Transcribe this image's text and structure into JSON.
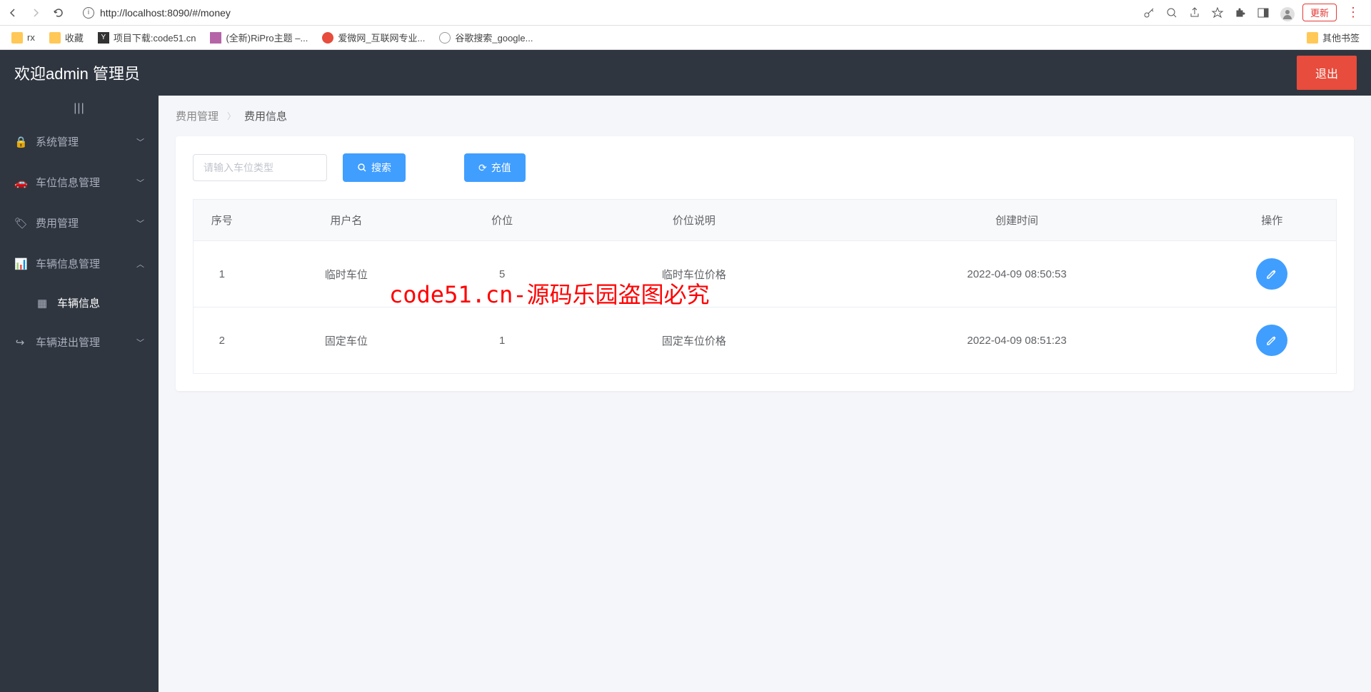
{
  "browser": {
    "url": "http://localhost:8090/#/money",
    "update_label": "更新"
  },
  "bookmarks": {
    "items": [
      {
        "label": "rx"
      },
      {
        "label": "收藏"
      },
      {
        "label": "项目下载:code51.cn"
      },
      {
        "label": "(全新)RiPro主题 –..."
      },
      {
        "label": "爱微网_互联网专业..."
      },
      {
        "label": "谷歌搜索_google..."
      }
    ],
    "other": "其他书签"
  },
  "header": {
    "title": "欢迎admin 管理员",
    "logout": "退出"
  },
  "sidebar": {
    "items": [
      {
        "label": "系统管理",
        "expanded": false
      },
      {
        "label": "车位信息管理",
        "expanded": false
      },
      {
        "label": "费用管理",
        "expanded": false
      },
      {
        "label": "车辆信息管理",
        "expanded": true,
        "children": [
          {
            "label": "车辆信息"
          }
        ]
      },
      {
        "label": "车辆进出管理",
        "expanded": false
      }
    ]
  },
  "breadcrumb": {
    "parent": "费用管理",
    "current": "费用信息"
  },
  "toolbar": {
    "search_placeholder": "请输入车位类型",
    "search_label": "搜索",
    "recharge_label": "充值"
  },
  "table": {
    "headers": [
      "序号",
      "用户名",
      "价位",
      "价位说明",
      "创建时间",
      "操作"
    ],
    "rows": [
      {
        "seq": "1",
        "username": "临时车位",
        "price": "5",
        "desc": "临时车位价格",
        "created": "2022-04-09 08:50:53"
      },
      {
        "seq": "2",
        "username": "固定车位",
        "price": "1",
        "desc": "固定车位价格",
        "created": "2022-04-09 08:51:23"
      }
    ]
  },
  "watermark": "code51.cn-源码乐园盗图必究"
}
